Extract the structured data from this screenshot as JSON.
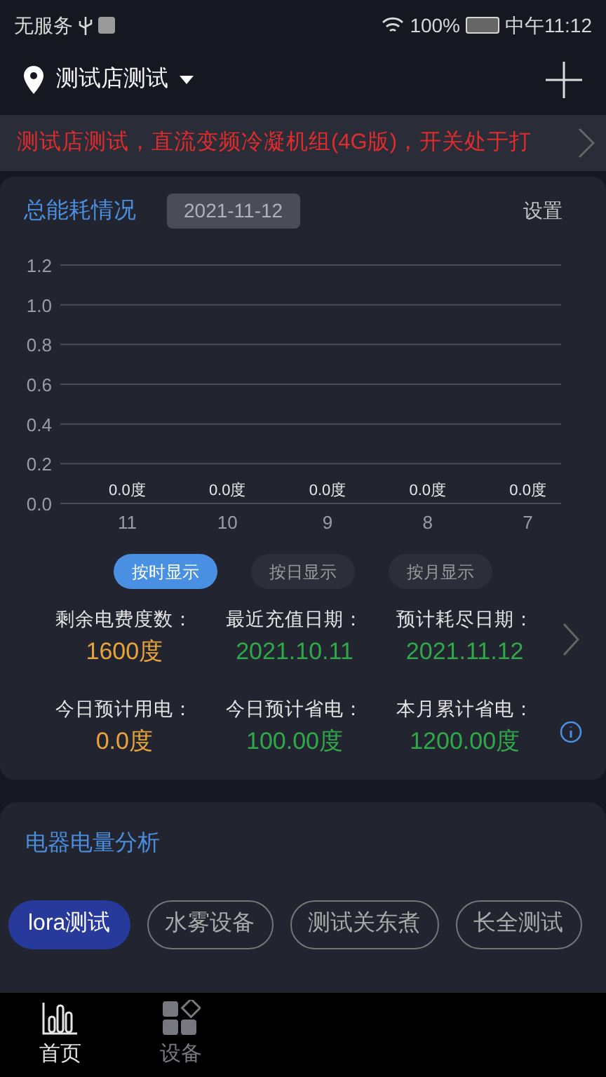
{
  "status_bar": {
    "carrier": "无服务",
    "battery": "100%",
    "time": "中午11:12"
  },
  "header": {
    "store": "测试店测试"
  },
  "notice": {
    "text": "测试店测试，直流变频冷凝机组(4G版)，开关处于打"
  },
  "energy": {
    "title": "总能耗情况",
    "date": "2021-11-12",
    "settings": "设置",
    "chart_data": {
      "type": "bar",
      "grid": true,
      "categories": [
        "11",
        "10",
        "9",
        "8",
        "7"
      ],
      "values": [
        0,
        0,
        0,
        0,
        0
      ],
      "ylim": [
        0,
        1.2
      ],
      "yticks": [
        {
          "value": 0,
          "label": "0.0"
        },
        {
          "value": 0.2,
          "label": "0.2"
        },
        {
          "value": 0.4,
          "label": "0.4"
        },
        {
          "value": 0.6,
          "label": "0.6"
        },
        {
          "value": 0.8,
          "label": "0.8"
        },
        {
          "value": 1,
          "label": "1.0"
        },
        {
          "value": 1.2,
          "label": "1.2"
        }
      ],
      "value_labels": [
        "0.0度",
        "0.0度",
        "0.0度",
        "0.0度",
        "0.0度"
      ]
    },
    "modes": [
      {
        "label": "按时显示",
        "selected": true
      },
      {
        "label": "按日显示",
        "selected": false
      },
      {
        "label": "按月显示",
        "selected": false
      }
    ],
    "stats": [
      {
        "label": "剩余电费度数：",
        "value": "1600度",
        "color": "#e8a33a"
      },
      {
        "label": "最近充值日期：",
        "value": "2021.10.11",
        "color": "#2fa84a"
      },
      {
        "label": "预计耗尽日期：",
        "value": "2021.11.12",
        "color": "#2fa84a"
      },
      {
        "label": "今日预计用电：",
        "value": "0.0度",
        "color": "#e8a33a"
      },
      {
        "label": "今日预计省电：",
        "value": "100.00度",
        "color": "#2fa84a"
      },
      {
        "label": "本月累计省电：",
        "value": "1200.00度",
        "color": "#2fa84a"
      }
    ]
  },
  "analysis": {
    "title": "电器电量分析",
    "devices": [
      {
        "label": "lora测试",
        "selected": true
      },
      {
        "label": "水雾设备",
        "selected": false
      },
      {
        "label": "测试关东煮",
        "selected": false
      },
      {
        "label": "长全测试",
        "selected": false
      }
    ]
  },
  "nav": [
    {
      "label": "首页",
      "selected": true,
      "kind": "home"
    },
    {
      "label": "设备",
      "selected": false,
      "kind": "devices"
    }
  ]
}
